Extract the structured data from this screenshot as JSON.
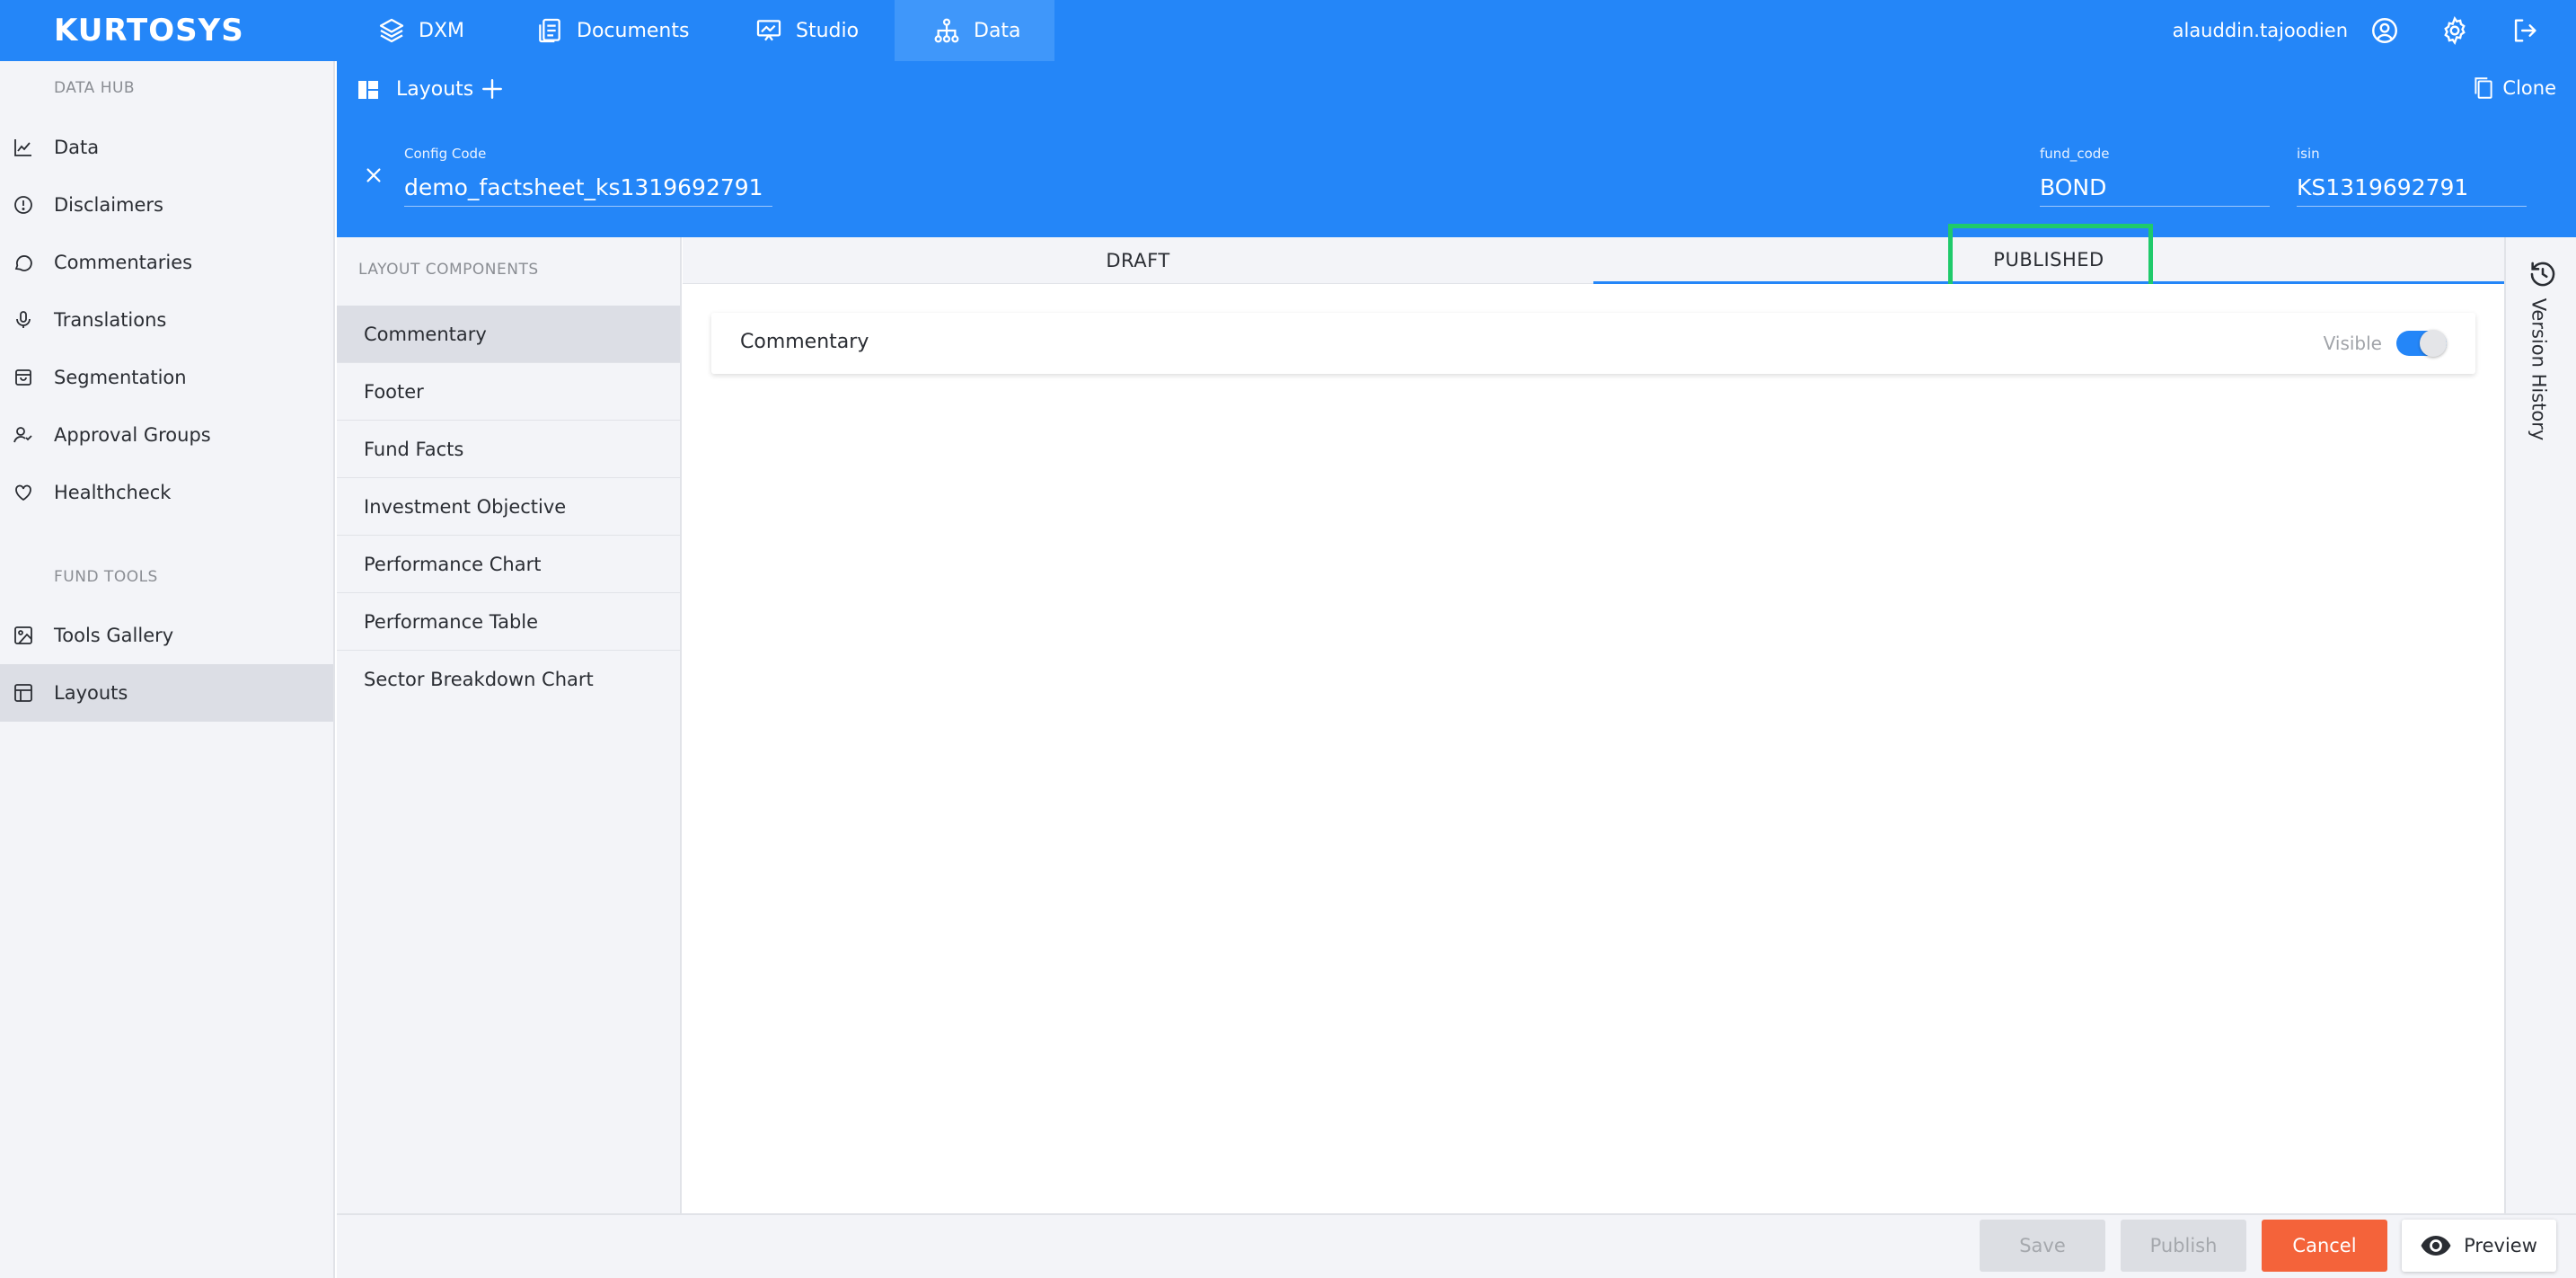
{
  "brand": {
    "logo_text": "KURTOSYS"
  },
  "topnav": {
    "items": [
      {
        "label": "DXM",
        "icon": "layers-icon"
      },
      {
        "label": "Documents",
        "icon": "documents-icon"
      },
      {
        "label": "Studio",
        "icon": "presentation-icon"
      },
      {
        "label": "Data",
        "icon": "hierarchy-icon",
        "active": true
      }
    ],
    "user": {
      "name": "alauddin.tajoodien"
    }
  },
  "sidebar": {
    "data_hub_header": "DATA HUB",
    "data_hub_items": [
      {
        "label": "Data",
        "icon": "line-chart-icon"
      },
      {
        "label": "Disclaimers",
        "icon": "alert-circle-icon"
      },
      {
        "label": "Commentaries",
        "icon": "chat-bubble-icon"
      },
      {
        "label": "Translations",
        "icon": "microphone-icon"
      },
      {
        "label": "Segmentation",
        "icon": "shopping-bag-icon"
      },
      {
        "label": "Approval Groups",
        "icon": "user-check-icon"
      },
      {
        "label": "Healthcheck",
        "icon": "heart-icon"
      }
    ],
    "fund_tools_header": "FUND TOOLS",
    "fund_tools_items": [
      {
        "label": "Tools Gallery",
        "icon": "image-icon"
      },
      {
        "label": "Layouts",
        "icon": "layout-icon",
        "active": true
      }
    ]
  },
  "subheader": {
    "title": "Layouts",
    "clone_label": "Clone"
  },
  "config": {
    "config_code_label": "Config Code",
    "config_code_value": "demo_factsheet_ks1319692791",
    "fund_code_label": "fund_code",
    "fund_code_value": "BOND",
    "isin_label": "isin",
    "isin_value": "KS1319692791"
  },
  "components": {
    "title": "LAYOUT COMPONENTS",
    "items": [
      "Commentary",
      "Footer",
      "Fund Facts",
      "Investment Objective",
      "Performance Chart",
      "Performance Table",
      "Sector Breakdown Chart"
    ],
    "active_index": 0
  },
  "tabs": {
    "draft": "DRAFT",
    "published": "PUBLISHED",
    "active": "published"
  },
  "card": {
    "title": "Commentary",
    "visible_label": "Visible",
    "visible": true
  },
  "version_history": {
    "label": "Version History"
  },
  "footer": {
    "save": "Save",
    "publish": "Publish",
    "cancel": "Cancel",
    "preview": "Preview"
  },
  "colors": {
    "primary": "#2486f8",
    "cancel": "#f4633a",
    "highlight": "#1fca6b",
    "sidebar_bg": "#f3f4f8",
    "active_bg": "#dcdee5"
  }
}
